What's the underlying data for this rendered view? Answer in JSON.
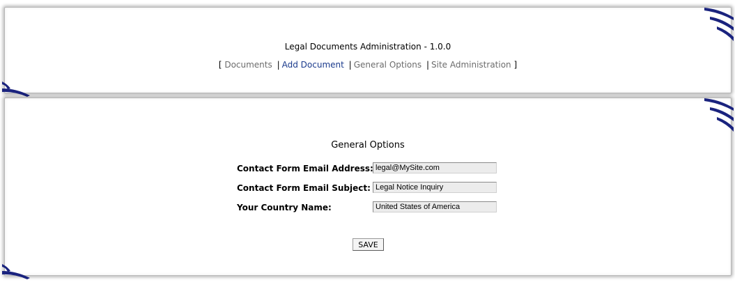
{
  "header": {
    "title": "Legal Documents Administration - 1.0.0",
    "nav_open": "[",
    "nav_close": "]",
    "separator": "|",
    "nav": {
      "documents": "Documents",
      "add_document": "Add Document",
      "general_options": "General Options",
      "site_administration": "Site Administration"
    }
  },
  "main": {
    "section_title": "General Options",
    "fields": {
      "email": {
        "label": "Contact Form Email Address:",
        "value": "legal@MySite.com"
      },
      "subject": {
        "label": "Contact Form Email Subject:",
        "value": "Legal Notice Inquiry"
      },
      "country": {
        "label": "Your Country Name:",
        "value": "United States of America"
      }
    },
    "save_label": "SAVE"
  },
  "colors": {
    "link_visited": "#6c6c6c",
    "link_active": "#1a3a8c",
    "corner_decoration": "#1a237e"
  },
  "icons": {
    "corner": "swoosh-corner-icon"
  }
}
